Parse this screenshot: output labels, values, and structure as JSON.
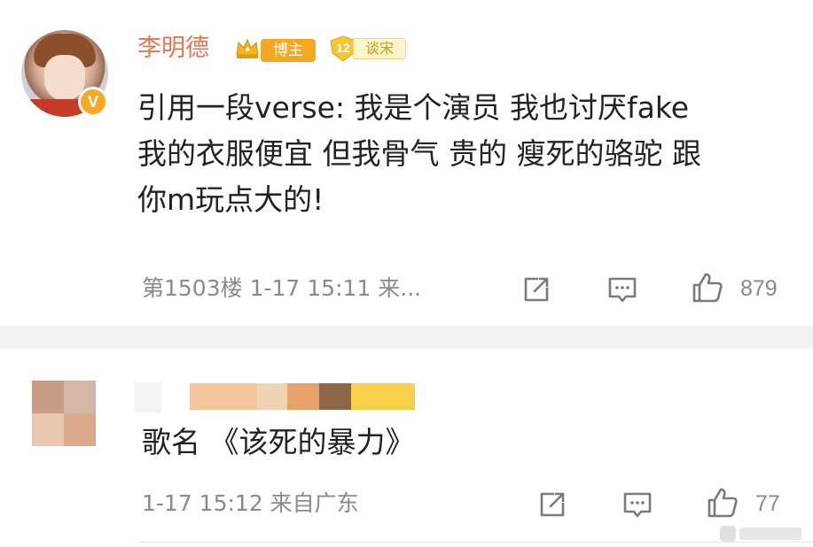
{
  "comment1": {
    "username": "李明德",
    "badges": {
      "crown_icon": "crown-icon",
      "blogger_label": "博主",
      "level_number": "12",
      "level_label": "谈宋"
    },
    "verified_mark": "V",
    "text": "引用一段verse: 我是个演员 我也讨厌fake\n我的衣服便宜 但我骨气 贵的 瘦死的骆驼 跟\n你m玩点大的!",
    "meta": "第1503楼 1-17 15:11 来...",
    "actions": {
      "share_icon": "share-icon",
      "comment_icon": "comment-icon",
      "like_icon": "thumbs-up-icon",
      "like_count": "879"
    }
  },
  "comment2": {
    "username_obscured": true,
    "text": "歌名 《该死的暴力》",
    "meta": "1-17 15:12 来自广东",
    "actions": {
      "share_icon": "share-icon",
      "comment_icon": "comment-icon",
      "like_icon": "thumbs-up-icon",
      "like_count": "77"
    }
  },
  "colors": {
    "username": "#eb7350",
    "meta": "#8a8a8a",
    "text": "#222222",
    "separator": "#f2f2f2",
    "blogger_badge": "#f5a623",
    "verified_badge": "#f9a825"
  }
}
